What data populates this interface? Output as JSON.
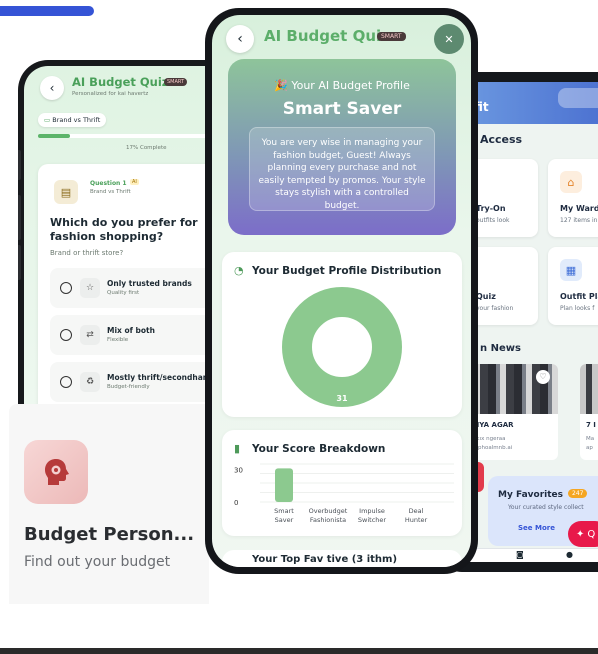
{
  "right_phone": {
    "header_title": "fit",
    "quick_access_title": "Access",
    "cards": [
      {
        "title": "Try-On",
        "sub": "outfits look",
        "icon": "hanger-icon"
      },
      {
        "title": "My Ward",
        "sub": "127 items in",
        "icon": "wardrobe-icon"
      },
      {
        "title": "Quiz",
        "sub": "your fashion",
        "icon": "quiz-icon"
      },
      {
        "title": "Outfit Pla",
        "sub": "Plan looks f",
        "icon": "calendar-icon"
      }
    ],
    "news_title": "n News",
    "news": [
      {
        "title": "ANYA AGAR",
        "line1": "Ek kıx ngeraa",
        "line2": "lo ophoalmnb.ai"
      },
      {
        "title": "7 I",
        "line1": "Ma",
        "line2": "ap"
      }
    ],
    "favorites": {
      "title": "My Favorites",
      "badge": "247",
      "sub": "Your curated style collect",
      "more": "See More"
    },
    "ai_button": "Q"
  },
  "left_phone": {
    "title": "AI Budget Quiz",
    "smart_badge": "SMART",
    "subtitle": "Personalized for kai havertz",
    "chip": "Brand vs Thrift",
    "progress": 0.17,
    "progress_label": "17% Complete",
    "question": {
      "number": "Question 1",
      "ai_badge": "AI",
      "category": "Brand vs Thrift",
      "text": "Which do you prefer for fashion shopping?",
      "hint": "Brand or thrift store?"
    },
    "options": [
      {
        "label": "Only trusted brands",
        "sub": "Quality first",
        "icon": "star-icon"
      },
      {
        "label": "Mix of both",
        "sub": "Flexible",
        "icon": "swap-icon"
      },
      {
        "label": "Mostly thrift/secondhand",
        "sub": "Budget-friendly",
        "icon": "recycle-icon"
      }
    ]
  },
  "profile_card": {
    "title": "Budget Person...",
    "subtitle": "Find out your budget",
    "icon": "head-gear-icon"
  },
  "center_phone": {
    "title": "AI Budget Quiz",
    "smart_badge": "SMART",
    "profile": {
      "label": "🎉 Your AI Budget Profile",
      "name": "Smart Saver",
      "description": "You are very wise in managing your fashion budget, Guest! Always planning every purchase and not easily tempted by promos. Your style stays stylish with a controlled budget."
    },
    "distribution": {
      "title": "Your Budget Profile Distribution",
      "value_label": "31"
    },
    "breakdown_title": "Your Score Breakdown",
    "next_section_title": "Your Top Fav tive (3 ithm)"
  },
  "chart_data": {
    "type": "bar",
    "title": "Your Score Breakdown",
    "categories": [
      "Smart Saver",
      "Overbudget Fashionista",
      "Impulse Switcher",
      "Deal Hunter"
    ],
    "values": [
      31,
      0,
      0,
      0
    ],
    "yticks": [
      "30",
      "0"
    ],
    "ylim": [
      0,
      35
    ],
    "color": "#8cc98f"
  },
  "pie_data": {
    "type": "pie",
    "title": "Your Budget Profile Distribution",
    "slices": [
      {
        "name": "Smart Saver",
        "value": 31
      }
    ],
    "color": "#8cc98f"
  }
}
